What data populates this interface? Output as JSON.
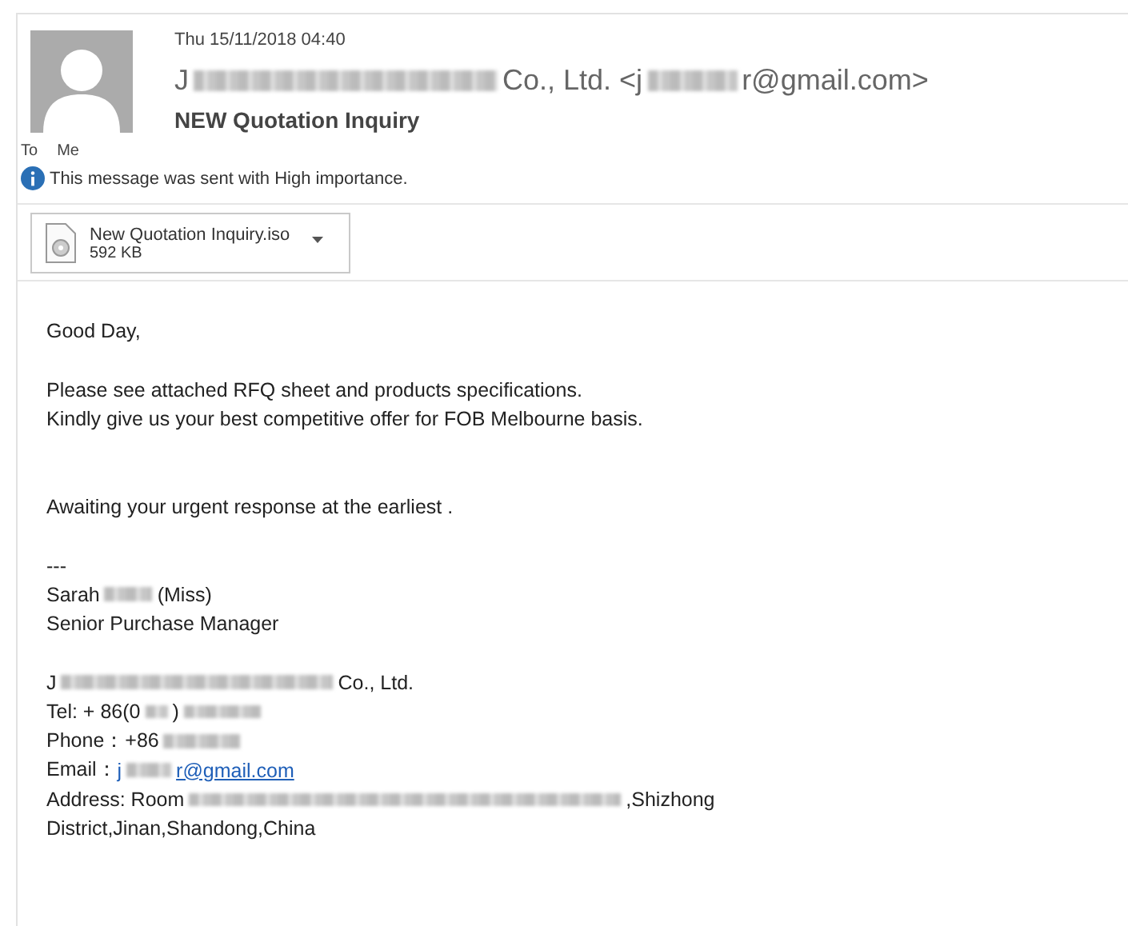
{
  "header": {
    "date": "Thu 15/11/2018 04:40",
    "sender": [
      {
        "kind": "text",
        "text": "J"
      },
      {
        "kind": "redacted"
      },
      {
        "kind": "text",
        "text": "Co., Ltd. <j"
      },
      {
        "kind": "redacted"
      },
      {
        "kind": "text",
        "text": "r@gmail.com>"
      }
    ],
    "subject": "NEW Quotation Inquiry",
    "to_label": "To",
    "to_value": "Me",
    "notice": "This message was sent with High importance."
  },
  "attachment": {
    "name": "New Quotation Inquiry.iso",
    "size": "592 KB"
  },
  "body": [
    {
      "kind": "line",
      "parts": [
        {
          "kind": "text",
          "text": "Good Day,"
        }
      ]
    },
    {
      "kind": "gap"
    },
    {
      "kind": "line",
      "parts": [
        {
          "kind": "text",
          "text": "Please see attached RFQ sheet and products specifications."
        }
      ]
    },
    {
      "kind": "line",
      "parts": [
        {
          "kind": "text",
          "text": "Kindly give us your best competitive offer for FOB Melbourne basis."
        }
      ]
    },
    {
      "kind": "gap"
    },
    {
      "kind": "gap"
    },
    {
      "kind": "line",
      "parts": [
        {
          "kind": "text",
          "text": "Awaiting  your urgent response at the earliest ."
        }
      ]
    },
    {
      "kind": "gap"
    },
    {
      "kind": "line",
      "parts": [
        {
          "kind": "text",
          "text": "---"
        }
      ]
    },
    {
      "kind": "line",
      "parts": [
        {
          "kind": "text",
          "text": "Sarah"
        },
        {
          "kind": "redacted"
        },
        {
          "kind": "text",
          "text": "(Miss)"
        }
      ]
    },
    {
      "kind": "line",
      "parts": [
        {
          "kind": "text",
          "text": "Senior Purchase Manager"
        }
      ]
    },
    {
      "kind": "gap"
    },
    {
      "kind": "line",
      "parts": [
        {
          "kind": "text",
          "text": "J"
        },
        {
          "kind": "redacted"
        },
        {
          "kind": "text",
          "text": "Co., Ltd."
        }
      ]
    },
    {
      "kind": "line",
      "parts": [
        {
          "kind": "text",
          "text": "Tel: + 86(0"
        },
        {
          "kind": "redacted"
        },
        {
          "kind": "text",
          "text": ")"
        },
        {
          "kind": "redacted"
        }
      ]
    },
    {
      "kind": "line",
      "parts": [
        {
          "kind": "text",
          "text": "Phone：+86"
        },
        {
          "kind": "redacted"
        }
      ]
    },
    {
      "kind": "line",
      "parts": [
        {
          "kind": "text",
          "text": "Email："
        },
        {
          "kind": "link",
          "parts": [
            {
              "kind": "text",
              "text": "j"
            },
            {
              "kind": "redacted"
            },
            {
              "kind": "text",
              "text": "r@gmail.com"
            }
          ]
        }
      ]
    },
    {
      "kind": "line",
      "parts": [
        {
          "kind": "text",
          "text": "Address: Room"
        },
        {
          "kind": "redacted"
        },
        {
          "kind": "text",
          "text": ",Shizhong"
        }
      ]
    },
    {
      "kind": "line",
      "parts": [
        {
          "kind": "text",
          "text": "District,Jinan,Shandong,China"
        }
      ]
    }
  ]
}
